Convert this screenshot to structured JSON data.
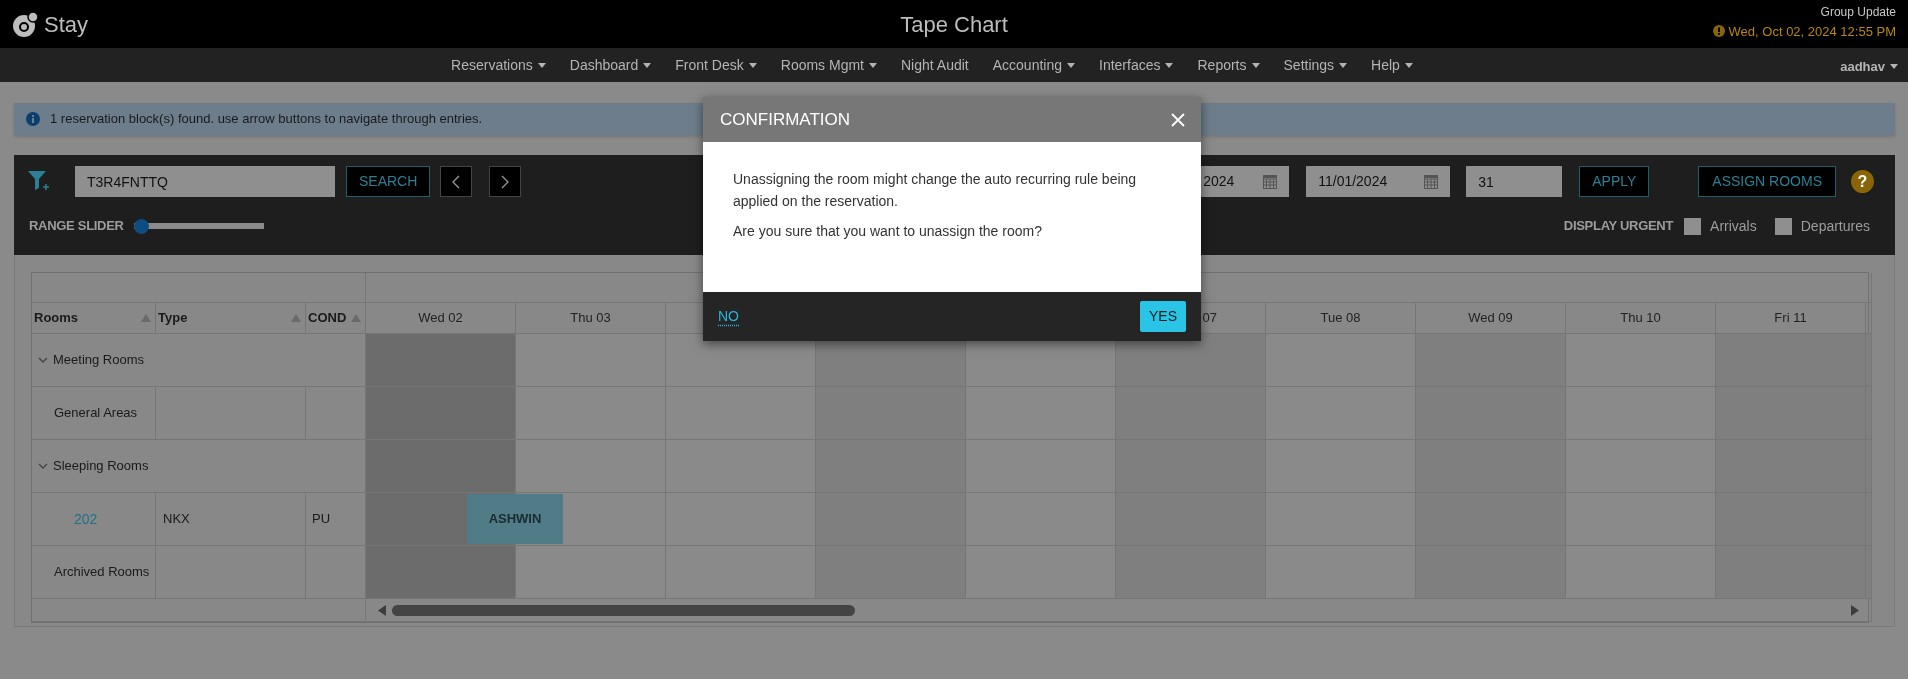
{
  "app": {
    "logo": "Stay",
    "title": "Tape Chart",
    "notice": "Group Update",
    "datetime": "Wed, Oct 02, 2024 12:55 PM"
  },
  "menu": [
    {
      "label": "Reservations",
      "dropdown": true
    },
    {
      "label": "Dashboard",
      "dropdown": true
    },
    {
      "label": "Front Desk",
      "dropdown": true
    },
    {
      "label": "Rooms Mgmt",
      "dropdown": true
    },
    {
      "label": "Night Audit",
      "dropdown": false
    },
    {
      "label": "Accounting",
      "dropdown": true
    },
    {
      "label": "Interfaces",
      "dropdown": true
    },
    {
      "label": "Reports",
      "dropdown": true
    },
    {
      "label": "Settings",
      "dropdown": true
    },
    {
      "label": "Help",
      "dropdown": true
    }
  ],
  "user": {
    "name": "aadhav"
  },
  "alert": {
    "message": "1 reservation block(s) found. use arrow buttons to navigate through entries."
  },
  "toolbar": {
    "search": {
      "value": "T3R4FNTTQ"
    },
    "search_button": "SEARCH",
    "date_from": {
      "value": "2024"
    },
    "date_to": {
      "value": "11/01/2024"
    },
    "nights": {
      "value": "31"
    },
    "apply_button": "APPLY",
    "assign_button": "ASSIGN ROOMS",
    "help": "?"
  },
  "range_slider": {
    "label": "RANGE SLIDER",
    "level": 0
  },
  "urgent": {
    "label": "DISPLAY URGENT",
    "options": [
      {
        "label": "Arrivals",
        "checked": false
      },
      {
        "label": "Departures",
        "checked": false
      }
    ]
  },
  "grid": {
    "columns": [
      {
        "label": "Rooms",
        "sortable": true
      },
      {
        "label": "Type",
        "sortable": true
      },
      {
        "label": "COND",
        "sortable": true
      }
    ],
    "days": [
      {
        "label": "Wed 02",
        "kind": "today"
      },
      {
        "label": "Thu 03",
        "kind": "light"
      },
      {
        "kind": "light"
      },
      {
        "kind": "dark"
      },
      {
        "kind": "light"
      },
      {
        "label": "07",
        "kind": "dark",
        "cut": true
      },
      {
        "label": "Tue 08",
        "kind": "light"
      },
      {
        "label": "Wed 09",
        "kind": "dark"
      },
      {
        "label": "Thu 10",
        "kind": "light"
      },
      {
        "label": "Fri 11",
        "kind": "dark"
      }
    ],
    "rows": [
      {
        "kind": "group",
        "label": "Meeting Rooms",
        "expanded": true
      },
      {
        "kind": "room",
        "room": "General Areas"
      },
      {
        "kind": "group",
        "label": "Sleeping Rooms",
        "expanded": true
      },
      {
        "kind": "room",
        "room": "202",
        "link": true,
        "type": "NKX",
        "cond": "PU",
        "reservations": [
          {
            "guest": "ASHWIN"
          }
        ]
      },
      {
        "kind": "room",
        "room": "Archived Rooms"
      }
    ]
  },
  "modal": {
    "title": "CONFIRMATION",
    "paragraphs": [
      "Unassigning the room might change the auto recurring rule being applied on the reservation.",
      "Are you sure that you want to unassign the room?"
    ],
    "no_link": "NO",
    "yes_button": "YES"
  }
}
